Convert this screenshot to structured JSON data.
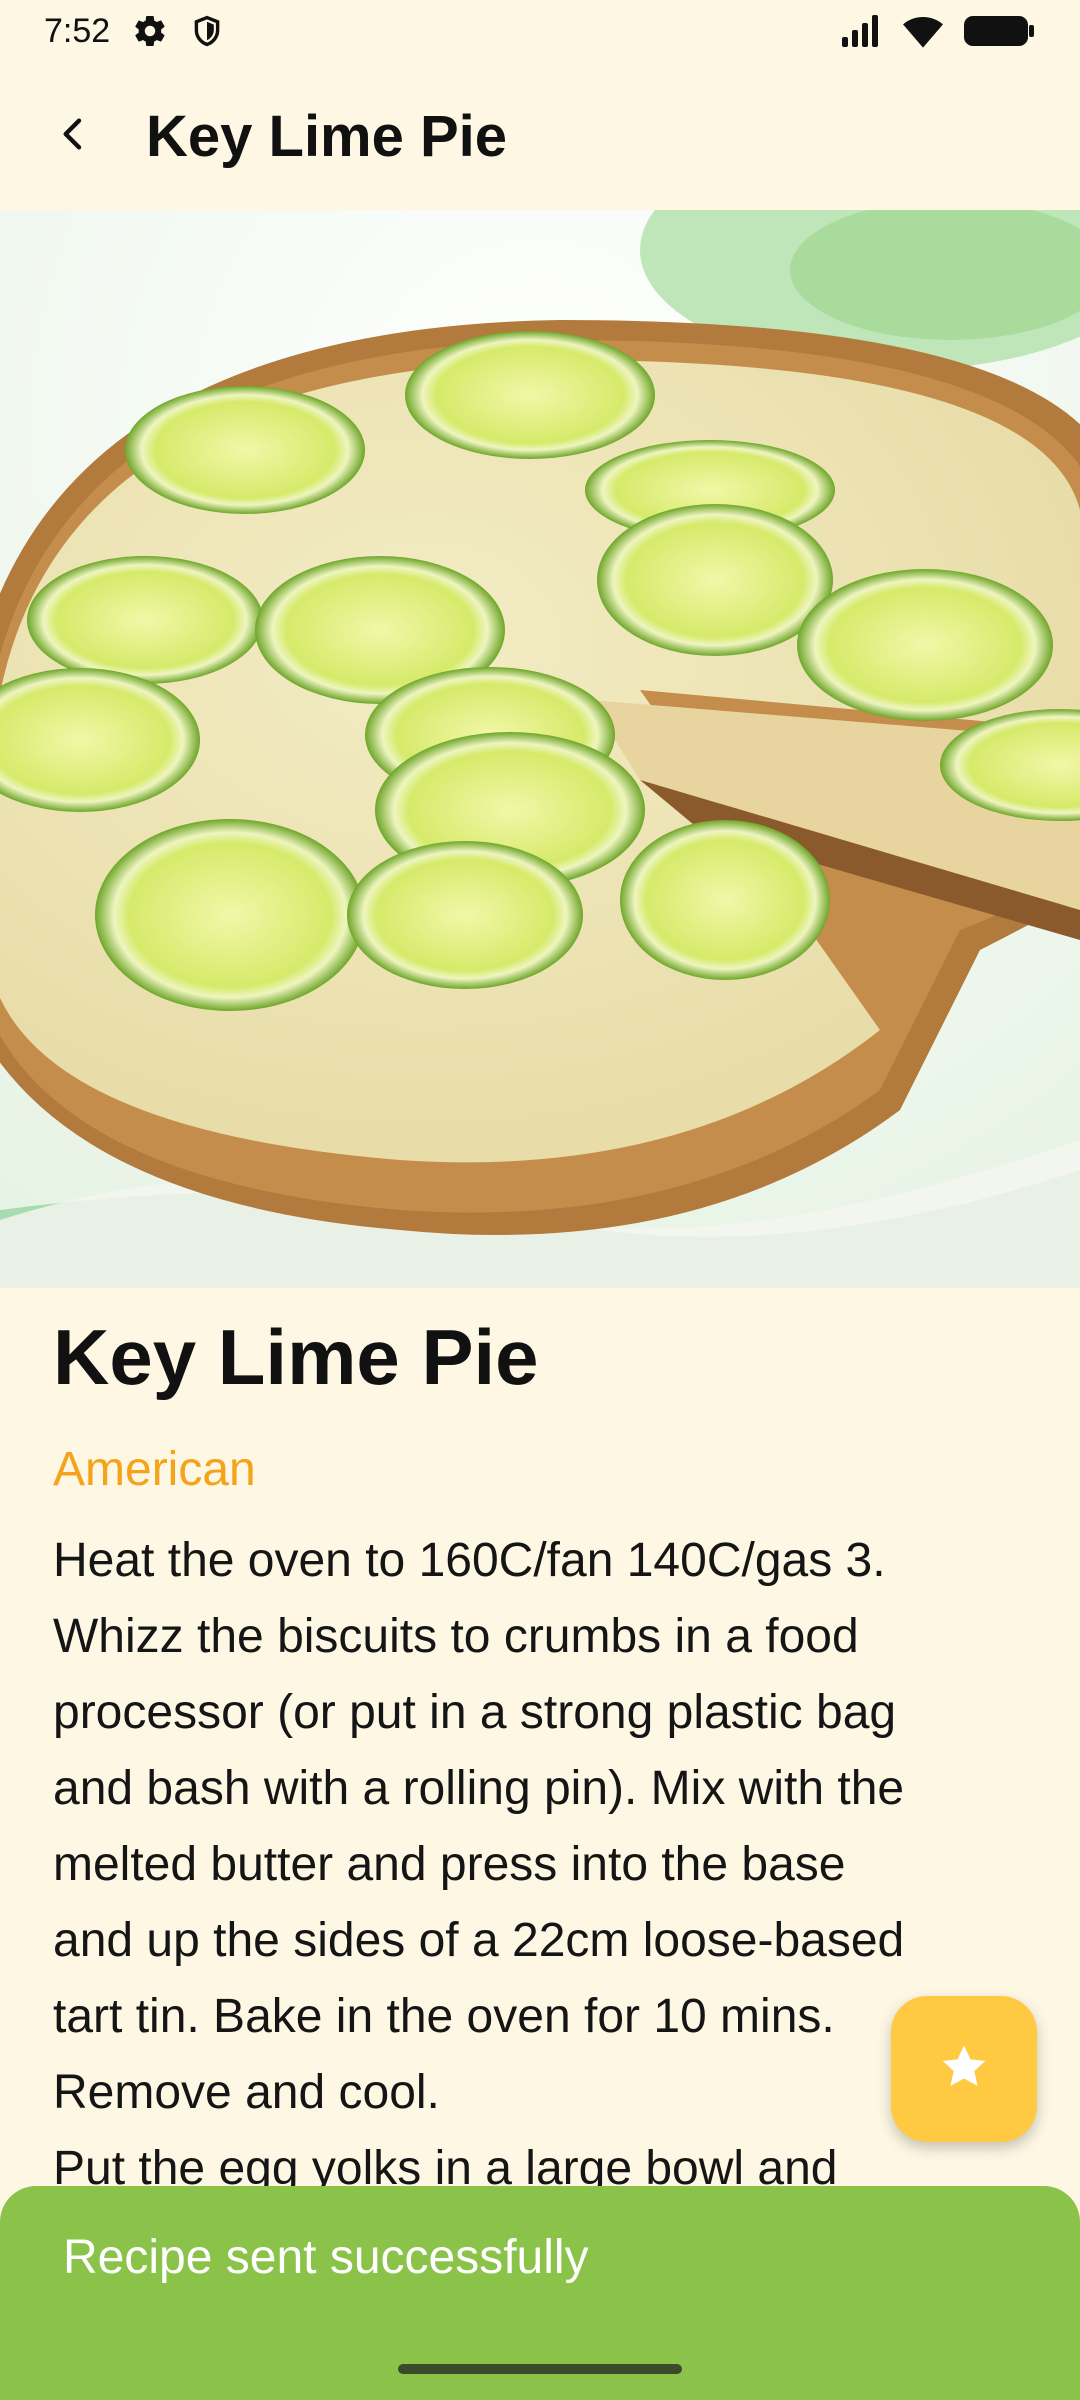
{
  "status_bar": {
    "time": "7:52",
    "icons": [
      "settings-icon",
      "shield-icon",
      "signal-icon",
      "wifi-icon",
      "battery-icon"
    ]
  },
  "app_bar": {
    "back_icon": "back-arrow-icon",
    "title": "Key Lime Pie"
  },
  "hero": {
    "image_icon": "key-lime-pie-photo"
  },
  "recipe": {
    "title": "Key Lime Pie",
    "cuisine": "American",
    "instructions_lines": [
      "Heat the oven to 160C/fan 140C/gas 3.",
      "Whizz the biscuits to crumbs in a food",
      "processor (or put in a strong plastic bag",
      "and bash with a rolling pin). Mix with the",
      "melted butter and press into the base",
      "and up the sides of a 22cm loose-based",
      "tart tin. Bake in the oven for 10 mins.",
      "Remove and cool.",
      "Put the egg yolks in a large bowl and"
    ]
  },
  "fab": {
    "icon": "star-icon"
  },
  "snackbar": {
    "message": "Recipe sent successfully"
  },
  "colors": {
    "background": "#FDF7E4",
    "accent_cuisine": "#F4A31B",
    "fab": "#FFC941",
    "snackbar": "#8BC34A"
  }
}
